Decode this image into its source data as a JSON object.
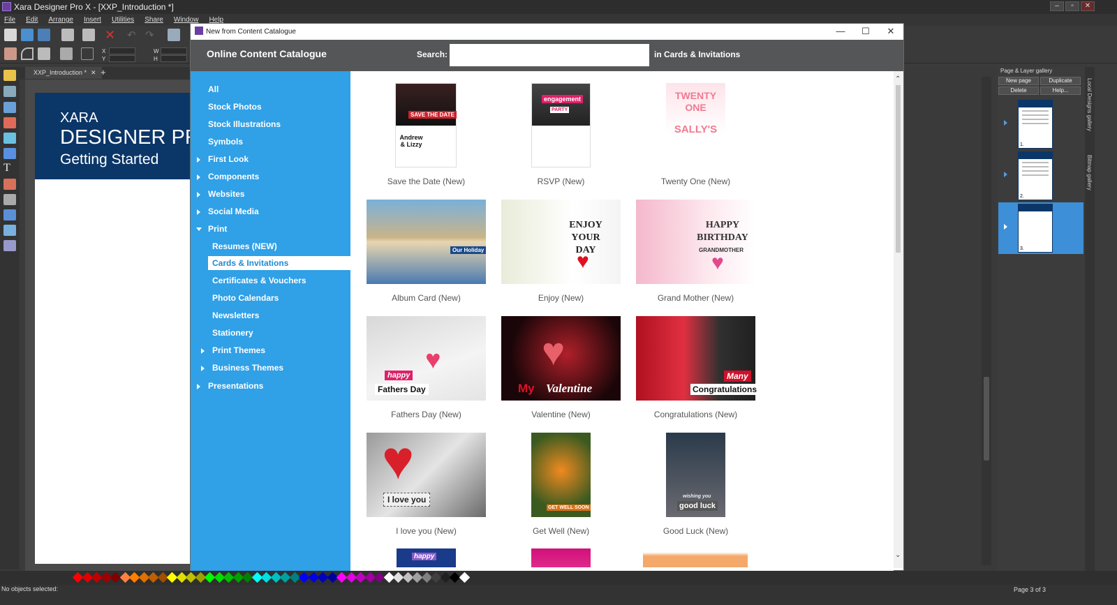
{
  "app": {
    "title": "Xara Designer Pro X - [XXP_Introduction *]",
    "menu": [
      "File",
      "Edit",
      "Arrange",
      "Insert",
      "Utilities",
      "Share",
      "Window",
      "Help"
    ],
    "doc_tab": "XXP_Introduction *",
    "status": "No objects selected:",
    "page_count": "Page 3 of 3",
    "coords": {
      "x_label": "X",
      "y_label": "Y",
      "w_label": "W",
      "h_label": "H"
    }
  },
  "document": {
    "banner_line1": "XARA",
    "banner_line2": "DESIGNER PRO",
    "banner_line3": "Getting Started"
  },
  "gallery": {
    "title": "Page & Layer gallery",
    "new_page": "New page",
    "duplicate": "Duplicate",
    "delete": "Delete",
    "help": "Help...",
    "pages": [
      "1.",
      "2.",
      "3."
    ],
    "side_tabs": [
      "Local Designs gallery",
      "Bitmap gallery"
    ]
  },
  "dialog": {
    "title": "New from Content Catalogue",
    "catalogue_title": "Online Content Catalogue",
    "search_label": "Search:",
    "search_value": "",
    "scope": "in Cards & Invitations",
    "nav": [
      {
        "label": "All"
      },
      {
        "label": "Stock Photos"
      },
      {
        "label": "Stock Illustrations"
      },
      {
        "label": "Symbols"
      },
      {
        "label": "First Look"
      },
      {
        "label": "Components"
      },
      {
        "label": "Websites"
      },
      {
        "label": "Social Media"
      },
      {
        "label": "Print"
      },
      {
        "label": "Resumes (NEW)"
      },
      {
        "label": "Cards & Invitations"
      },
      {
        "label": "Certificates & Vouchers"
      },
      {
        "label": "Photo Calendars"
      },
      {
        "label": "Newsletters"
      },
      {
        "label": "Stationery"
      },
      {
        "label": "Print Themes"
      },
      {
        "label": "Business Themes"
      },
      {
        "label": "Presentations"
      }
    ],
    "items": [
      {
        "caption": "Save the Date (New)",
        "overlay": "SAVE THE DATE",
        "sub": "Andrew & Lizzy"
      },
      {
        "caption": "RSVP (New)",
        "overlay": "engagement",
        "sub": "PARTY"
      },
      {
        "caption": "Twenty One (New)",
        "overlay": "TWENTY ONE",
        "sub": "SALLY'S"
      },
      {
        "caption": "Album Card (New)",
        "overlay": "Our Holiday"
      },
      {
        "caption": "Enjoy (New)",
        "overlay": "ENJOY YOUR DAY"
      },
      {
        "caption": "Grand Mother (New)",
        "overlay": "HAPPY BIRTHDAY",
        "sub": "GRANDMOTHER"
      },
      {
        "caption": "Fathers Day (New)",
        "overlay": "happy",
        "sub": "Fathers Day"
      },
      {
        "caption": "Valentine (New)",
        "overlay": "My",
        "sub": "Valentine"
      },
      {
        "caption": "Congratulations (New)",
        "overlay": "Many",
        "sub": "Congratulations"
      },
      {
        "caption": "I love you (New)",
        "overlay": "I love you"
      },
      {
        "caption": "Get Well (New)",
        "overlay": "GET WELL SOON"
      },
      {
        "caption": "Good Luck (New)",
        "overlay": "wishing you",
        "sub": "good luck"
      },
      {
        "caption": "",
        "overlay": "happy"
      }
    ]
  },
  "colors": {
    "sidebar": "#30a0e7",
    "header": "#555657",
    "banner": "#0b3668",
    "selected_page": "#3d8fd8"
  },
  "palette": [
    "#ff0000",
    "#e00000",
    "#c00000",
    "#a00000",
    "#800000",
    "#ff8040",
    "#ff8000",
    "#e07000",
    "#c06000",
    "#a05000",
    "#ffff00",
    "#e0e000",
    "#c0c000",
    "#a0a000",
    "#00ff00",
    "#00e000",
    "#00c000",
    "#00a000",
    "#008000",
    "#00ffff",
    "#00e0e0",
    "#00c0c0",
    "#00a0a0",
    "#008080",
    "#0000ff",
    "#0000e0",
    "#0000c0",
    "#0000a0",
    "#ff00ff",
    "#e000e0",
    "#c000c0",
    "#a000a0",
    "#800080",
    "#ffffff",
    "#e0e0e0",
    "#c0c0c0",
    "#a0a0a0",
    "#808080",
    "#404040",
    "#202020",
    "#000000",
    "#ffffff"
  ]
}
